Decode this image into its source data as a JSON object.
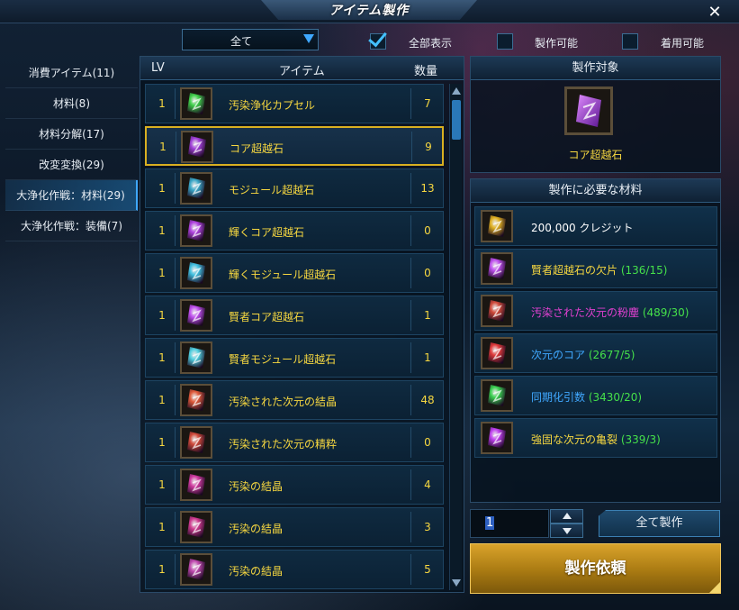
{
  "window": {
    "title": "アイテム製作",
    "close_glyph": "✕"
  },
  "filter": {
    "dropdown_value": "全て",
    "checkboxes": [
      {
        "label": "全部表示",
        "checked": true
      },
      {
        "label": "製作可能",
        "checked": false
      },
      {
        "label": "着用可能",
        "checked": false
      }
    ]
  },
  "categories": [
    {
      "label": "消費アイテム(11)",
      "active": false
    },
    {
      "label": "材料(8)",
      "active": false
    },
    {
      "label": "材料分解(17)",
      "active": false
    },
    {
      "label": "改変変換(29)",
      "active": false
    },
    {
      "label": "大浄化作戦：材料(29)",
      "active": true
    },
    {
      "label": "大浄化作戦：装備(7)",
      "active": false
    }
  ],
  "list": {
    "headers": {
      "lv": "LV",
      "item": "アイテム",
      "qty": "数量"
    },
    "rows": [
      {
        "lv": "1",
        "name": "汚染浄化カプセル",
        "qty": "7",
        "icon": "capsule-icon",
        "color": "#3fd04a"
      },
      {
        "lv": "1",
        "name": "コア超越石",
        "qty": "9",
        "icon": "core-stone-icon",
        "color": "#a040d8",
        "selected": true
      },
      {
        "lv": "1",
        "name": "モジュール超越石",
        "qty": "13",
        "icon": "module-stone-icon",
        "color": "#3aa8c8"
      },
      {
        "lv": "1",
        "name": "輝くコア超越石",
        "qty": "0",
        "icon": "shining-core-stone-icon",
        "color": "#b044e0"
      },
      {
        "lv": "1",
        "name": "輝くモジュール超越石",
        "qty": "0",
        "icon": "shining-module-stone-icon",
        "color": "#40c0e0"
      },
      {
        "lv": "1",
        "name": "賢者コア超越石",
        "qty": "1",
        "icon": "sage-core-stone-icon",
        "color": "#c050f0"
      },
      {
        "lv": "1",
        "name": "賢者モジュール超越石",
        "qty": "1",
        "icon": "sage-module-stone-icon",
        "color": "#50d0e0"
      },
      {
        "lv": "1",
        "name": "汚染された次元の結晶",
        "qty": "48",
        "icon": "dimension-crystal-icon",
        "color": "#e05a3a"
      },
      {
        "lv": "1",
        "name": "汚染された次元の精粋",
        "qty": "0",
        "icon": "dimension-essence-icon",
        "color": "#d04a3a"
      },
      {
        "lv": "1",
        "name": "汚染の結晶",
        "qty": "4",
        "icon": "contamination-crystal-icon",
        "color": "#d03aa0"
      },
      {
        "lv": "1",
        "name": "汚染の結晶",
        "qty": "3",
        "icon": "contamination-crystal-icon",
        "color": "#d03a90"
      },
      {
        "lv": "1",
        "name": "汚染の結晶",
        "qty": "5",
        "icon": "contamination-crystal-icon",
        "color": "#c04ab0"
      }
    ]
  },
  "target": {
    "header": "製作対象",
    "name": "コア超越石",
    "icon": "core-stone-icon",
    "color": "#a040d8"
  },
  "materials": {
    "header": "製作に必要な材料",
    "items": [
      {
        "name": "200,000 クレジット",
        "count": "",
        "name_color": "#ffffff",
        "icon": "credit-icon",
        "color": "#e0b020"
      },
      {
        "name": "賢者超越石の欠片",
        "count": "(136/15)",
        "name_color": "#f6d740",
        "icon": "sage-shard-icon",
        "color": "#c050f0"
      },
      {
        "name": "汚染された次元の粉塵",
        "count": "(489/30)",
        "name_color": "#e040d0",
        "icon": "dimension-dust-icon",
        "color": "#d04a3a"
      },
      {
        "name": "次元のコア",
        "count": "(2677/5)",
        "name_color": "#40a8ff",
        "icon": "dimension-core-icon",
        "color": "#e03a3a"
      },
      {
        "name": "同期化引数",
        "count": "(3430/20)",
        "name_color": "#40a8ff",
        "icon": "sync-argument-icon",
        "color": "#3ad050"
      },
      {
        "name": "強固な次元の亀裂",
        "count": "(339/3)",
        "name_color": "#f6d740",
        "icon": "dimension-rift-icon",
        "color": "#c040f0"
      }
    ]
  },
  "controls": {
    "quantity": "1",
    "make_all_label": "全て製作",
    "craft_label": "製作依頼"
  }
}
